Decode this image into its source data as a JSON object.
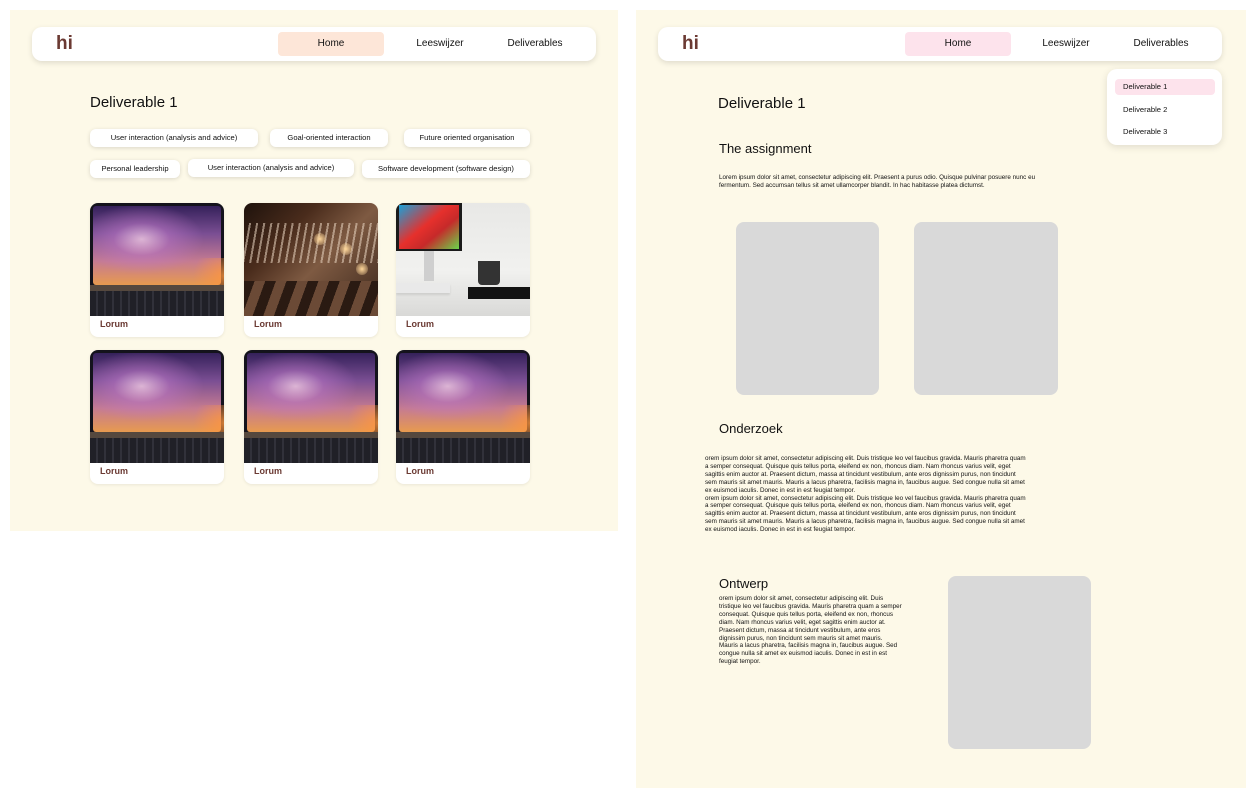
{
  "colors": {
    "background": "#fdf9e8",
    "brand": "#6b3a33",
    "home_left_bg": "#fde6d8",
    "home_right_bg": "#fde3ec",
    "placeholder": "#d9d9d9"
  },
  "left": {
    "logo": "hi",
    "nav": {
      "home": "Home",
      "guide": "Leeswijzer",
      "deliverables": "Deliverables"
    },
    "title": "Deliverable 1",
    "tags": [
      "User interaction (analysis and advice)",
      "Goal-oriented interaction",
      "Future oriented organisation",
      "Personal leadership",
      "User interaction (analysis and advice)",
      "Software development (software design)"
    ],
    "cards": [
      {
        "label": "Lorum",
        "image": "laptop-image"
      },
      {
        "label": "Lorum",
        "image": "clothes-rack-image"
      },
      {
        "label": "Lorum",
        "image": "desk-image"
      },
      {
        "label": "Lorum",
        "image": "laptop-image"
      },
      {
        "label": "Lorum",
        "image": "laptop-image"
      },
      {
        "label": "Lorum",
        "image": "laptop-image"
      }
    ]
  },
  "right": {
    "logo": "hi",
    "nav": {
      "home": "Home",
      "guide": "Leeswijzer",
      "deliverables": "Deliverables"
    },
    "dropdown": [
      "Deliverable 1",
      "Deliverable 2",
      "Deliverable 3"
    ],
    "title": "Deliverable 1",
    "assignment": {
      "title": "The assignment",
      "lines": [
        "Lorem ipsum dolor sit amet, consectetur adipiscing elit. Praesent a purus odio. Quisque pulvinar posuere nunc eu",
        "fermentum. Sed accumsan tellus sit amet ullamcorper blandit. In hac habitasse platea dictumst."
      ]
    },
    "research": {
      "title": "Onderzoek",
      "lines": [
        "orem ipsum dolor sit amet, consectetur adipiscing elit. Duis tristique leo vel faucibus gravida. Mauris pharetra quam",
        "a semper consequat. Quisque quis tellus porta, eleifend ex non, rhoncus diam. Nam rhoncus varius velit, eget",
        "sagittis enim auctor at. Praesent dictum, massa at tincidunt vestibulum, ante eros dignissim purus, non tincidunt",
        "sem mauris sit amet mauris. Mauris a lacus pharetra, facilisis magna in, faucibus augue. Sed congue nulla sit amet",
        "ex euismod iaculis. Donec in est in est feugiat tempor.",
        "orem ipsum dolor sit amet, consectetur adipiscing elit. Duis tristique leo vel faucibus gravida. Mauris pharetra quam",
        "a semper consequat. Quisque quis tellus porta, eleifend ex non, rhoncus diam. Nam rhoncus varius velit, eget",
        "sagittis enim auctor at. Praesent dictum, massa at tincidunt vestibulum, ante eros dignissim purus, non tincidunt",
        "sem mauris sit amet mauris. Mauris a lacus pharetra, facilisis magna in, faucibus augue. Sed congue nulla sit amet",
        "ex euismod iaculis. Donec in est in est feugiat tempor."
      ]
    },
    "design": {
      "title": "Ontwerp",
      "lines": [
        "orem ipsum dolor sit amet, consectetur adipiscing elit. Duis",
        "tristique leo vel faucibus gravida. Mauris pharetra quam a semper",
        "consequat. Quisque quis tellus porta, eleifend ex non, rhoncus",
        "diam. Nam rhoncus varius velit, eget sagittis enim auctor at.",
        "Praesent dictum, massa at tincidunt vestibulum, ante eros",
        "dignissim purus, non tincidunt sem mauris sit amet mauris.",
        "Mauris a lacus pharetra, facilisis magna in, faucibus augue. Sed",
        "congue nulla sit amet ex euismod iaculis. Donec in est in est",
        "feugiat tempor."
      ]
    }
  }
}
